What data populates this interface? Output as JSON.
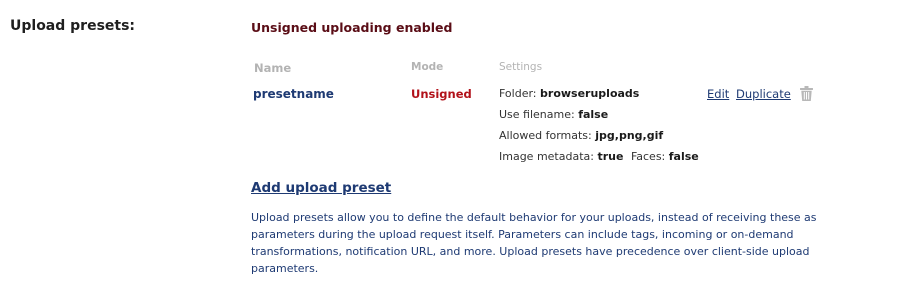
{
  "section": {
    "label": "Upload presets:"
  },
  "status": "Unsigned uploading enabled",
  "table": {
    "headers": {
      "name": "Name",
      "mode": "Mode",
      "settings": "Settings"
    },
    "rows": [
      {
        "name": "presetname",
        "mode": "Unsigned",
        "settings": {
          "folder_label": "Folder:",
          "folder_value": "browseruploads",
          "use_filename_label": "Use filename:",
          "use_filename_value": "false",
          "allowed_formats_label": "Allowed formats:",
          "allowed_formats_value": "jpg,png,gif",
          "image_metadata_label": "Image metadata:",
          "image_metadata_value": "true",
          "faces_label": "Faces:",
          "faces_value": "false"
        },
        "actions": {
          "edit": "Edit",
          "duplicate": "Duplicate",
          "delete_icon": "trash-icon"
        }
      }
    ]
  },
  "add_preset_label": "Add upload preset",
  "description": "Upload presets allow you to define the default behavior for your uploads, instead of receiving these as parameters during the upload request itself. Parameters can include tags, incoming or on-demand transformations, notification URL, and more. Upload presets have precedence over client-side upload parameters.",
  "colors": {
    "link": "#1e3a73",
    "unsigned": "#b1121a",
    "status": "#5a0d16",
    "header": "#b3b3b3"
  }
}
